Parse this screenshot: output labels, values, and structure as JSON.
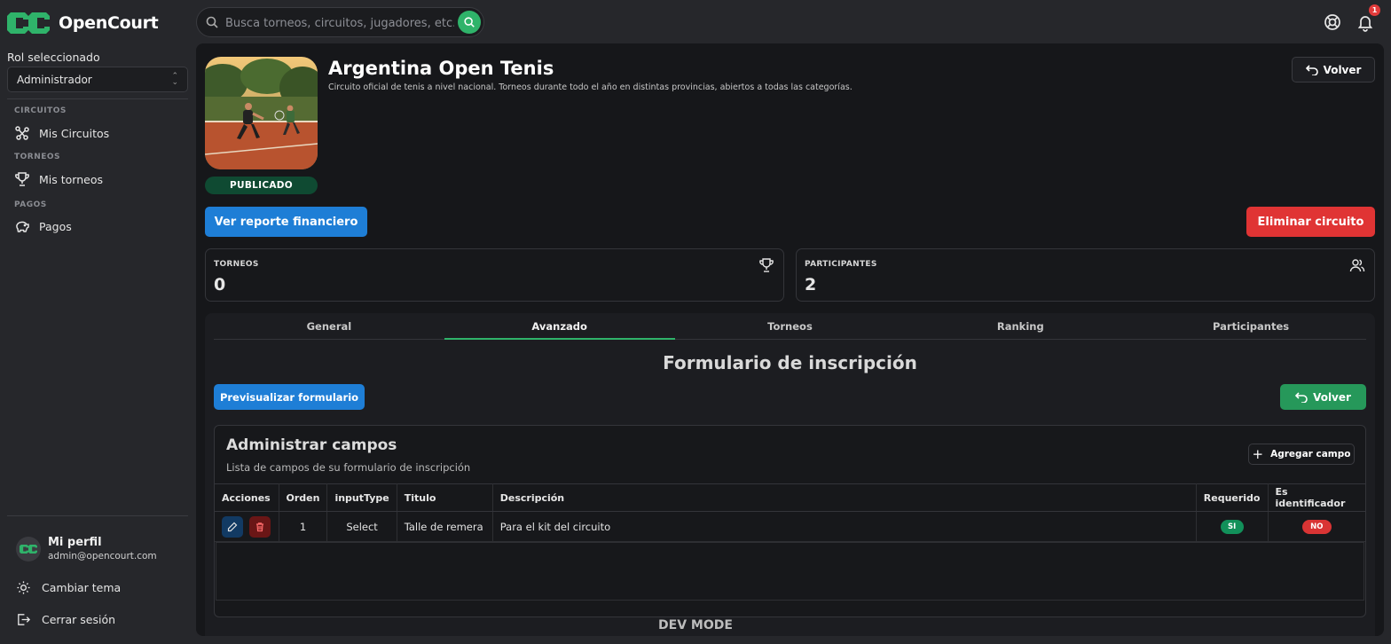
{
  "app": {
    "name": "OpenCourt",
    "search_placeholder": "Busca torneos, circuitos, jugadores, etc.",
    "notification_count": "1",
    "accent_color": "#2fb36a"
  },
  "sidebar": {
    "role_label": "Rol seleccionado",
    "role_value": "Administrador",
    "sections": [
      {
        "title": "CIRCUITOS",
        "item": "Mis Circuitos"
      },
      {
        "title": "TORNEOS",
        "item": "Mis torneos"
      },
      {
        "title": "PAGOS",
        "item": "Pagos"
      }
    ],
    "profile": {
      "name": "Mi perfil",
      "email": "admin@opencourt.com"
    },
    "theme_label": "Cambiar tema",
    "logout_label": "Cerrar sesión"
  },
  "circuit": {
    "title": "Argentina Open Tenis",
    "description": "Circuito oficial de tenis a nivel nacional. Torneos durante todo el año en distintas provincias, abiertos a todas las categorías.",
    "status": "PUBLICADO",
    "back_label": "Volver",
    "report_label": "Ver reporte financiero",
    "delete_label": "Eliminar circuito"
  },
  "stats": [
    {
      "label": "TORNEOS",
      "value": "0",
      "icon": "trophy-icon"
    },
    {
      "label": "PARTICIPANTES",
      "value": "2",
      "icon": "users-icon"
    }
  ],
  "tabs": [
    {
      "label": "General",
      "active": false
    },
    {
      "label": "Avanzado",
      "active": true
    },
    {
      "label": "Torneos",
      "active": false
    },
    {
      "label": "Ranking",
      "active": false
    },
    {
      "label": "Participantes",
      "active": false
    }
  ],
  "form": {
    "title": "Formulario de inscripción",
    "preview_label": "Previsualizar formulario",
    "back_label": "Volver",
    "fields_title": "Administrar campos",
    "fields_subtitle": "Lista de campos de su formulario de inscripción",
    "add_label": "Agregar campo",
    "columns": [
      "Acciones",
      "Orden",
      "inputType",
      "Titulo",
      "Descripción",
      "Requerido",
      "Es identificador"
    ],
    "rows": [
      {
        "orden": "1",
        "inputType": "Select",
        "titulo": "Talle de remera",
        "descripcion": "Para el kit del circuito",
        "requerido": "SI",
        "identificador": "NO"
      }
    ]
  },
  "footer": {
    "dev_mode": "DEV MODE"
  }
}
